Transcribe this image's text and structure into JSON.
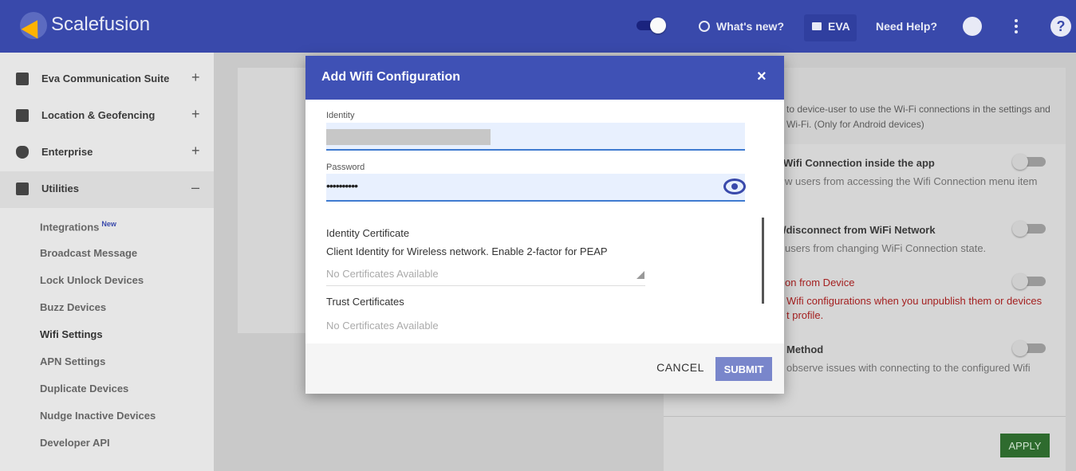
{
  "header": {
    "brand": "Scalefusion",
    "whats_new": "What's new?",
    "eva": "EVA",
    "need_help": "Need Help?",
    "help_glyph": "?"
  },
  "sidebar": {
    "sections": [
      {
        "label": "Eva Communication Suite",
        "toggle": "+"
      },
      {
        "label": "Location & Geofencing",
        "toggle": "+"
      },
      {
        "label": "Enterprise",
        "toggle": "+"
      },
      {
        "label": "Utilities",
        "toggle": "–"
      }
    ],
    "subitems": [
      {
        "label": "Integrations",
        "badge": "New"
      },
      {
        "label": "Broadcast Message"
      },
      {
        "label": "Lock Unlock Devices"
      },
      {
        "label": "Buzz Devices"
      },
      {
        "label": "Wifi Settings"
      },
      {
        "label": "APN Settings"
      },
      {
        "label": "Duplicate Devices"
      },
      {
        "label": "Nudge Inactive Devices"
      },
      {
        "label": "Developer API"
      }
    ]
  },
  "background_panel": {
    "intro_line1": "to device-user to use the Wi-Fi connections in the settings and",
    "intro_line2": "Wi-Fi. (Only for Android devices)",
    "settings": [
      {
        "title": "Wifi Connection inside the app",
        "desc": "w users from accessing the Wifi Connection menu item"
      },
      {
        "title": "/disconnect from WiFi Network",
        "desc": "users from changing WiFi Connection state."
      },
      {
        "title": "on from Device",
        "desc_line1": "Wifi configurations when you unpublish them or devices",
        "desc_line2": "t profile."
      },
      {
        "title": "Method",
        "desc": "observe issues with connecting to the configured Wifi"
      }
    ],
    "apply": "APPLY"
  },
  "modal": {
    "title": "Add Wifi Configuration",
    "close": "×",
    "identity_label": "Identity",
    "password_label": "Password",
    "password_value": "••••••••••",
    "identity_cert_title": "Identity Certificate",
    "identity_cert_desc": "Client Identity for Wireless network. Enable 2-factor for PEAP",
    "identity_cert_value": "No Certificates Available",
    "trust_cert_title": "Trust Certificates",
    "trust_cert_value": "No Certificates Available",
    "cancel": "CANCEL",
    "submit": "SUBMIT"
  },
  "colors": {
    "topbar": "#3949ab",
    "modal_header": "#3f51b5",
    "submit": "#7986cb",
    "apply": "#2e6b2e",
    "danger": "#a42020"
  }
}
